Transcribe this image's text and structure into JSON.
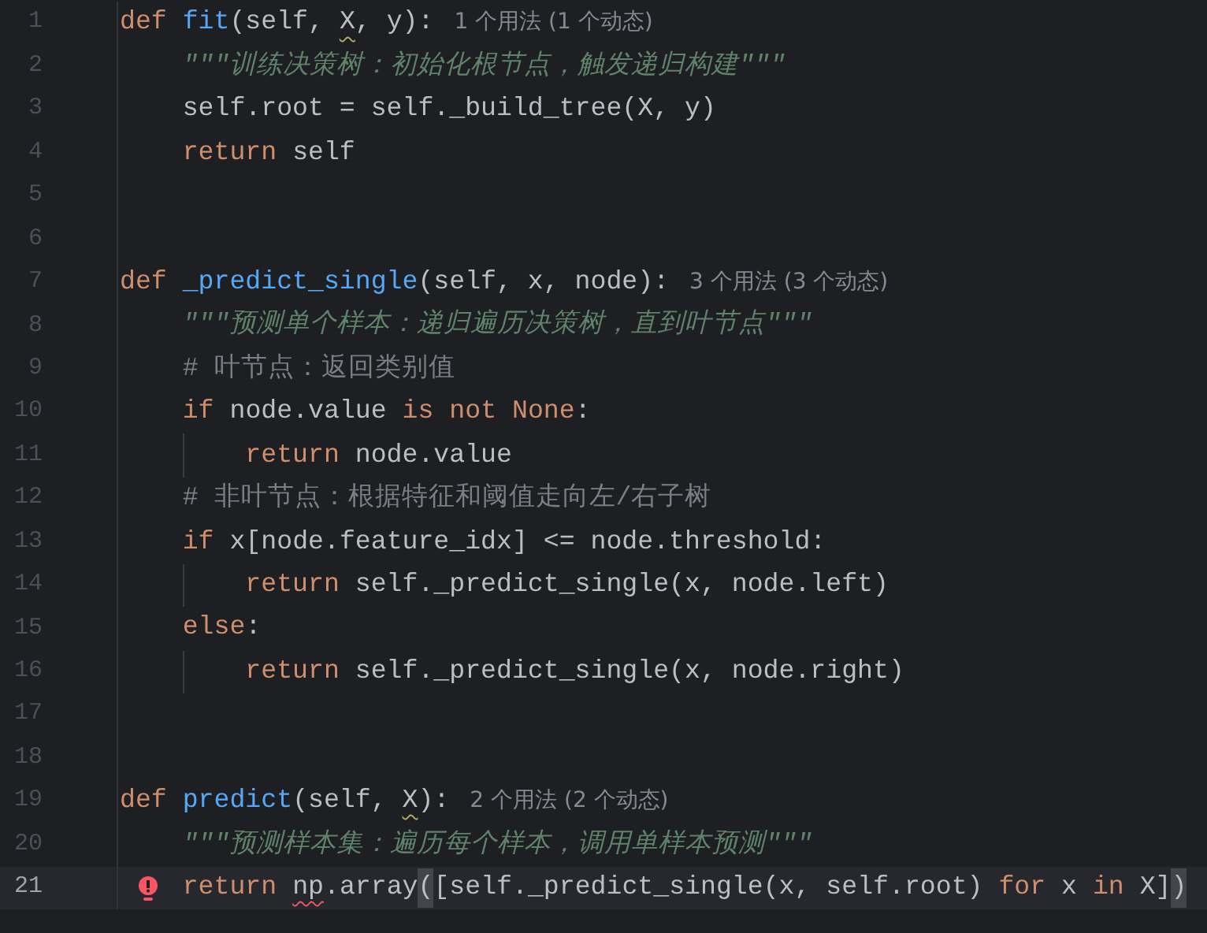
{
  "lines": [
    {
      "number": "1",
      "current": false,
      "error": false,
      "tokens": [
        {
          "kind": "kw",
          "text": "def"
        },
        {
          "kind": "fn",
          "text": " fit"
        },
        {
          "kind": "plain",
          "text": "(self, "
        },
        {
          "kind": "warn_name",
          "text": "X"
        },
        {
          "kind": "plain",
          "text": ", y):"
        },
        {
          "kind": "hint",
          "text": "1 个用法 (1 个动态)"
        }
      ]
    },
    {
      "number": "2",
      "current": false,
      "error": false,
      "tokens": [
        {
          "kind": "doc",
          "text": "    \"\"\"训练决策树：初始化根节点，触发递归构建\"\"\""
        }
      ]
    },
    {
      "number": "3",
      "current": false,
      "error": false,
      "tokens": [
        {
          "kind": "plain",
          "text": "    self.root = self._build_tree(X, y)"
        }
      ]
    },
    {
      "number": "4",
      "current": false,
      "error": false,
      "tokens": [
        {
          "kind": "kw",
          "text": "    return"
        },
        {
          "kind": "plain",
          "text": " self"
        }
      ]
    },
    {
      "number": "5",
      "current": false,
      "error": false
    },
    {
      "number": "6",
      "current": false,
      "error": false
    },
    {
      "number": "7",
      "current": false,
      "error": false,
      "tokens": [
        {
          "kind": "kw",
          "text": "def"
        },
        {
          "kind": "fn",
          "text": " _predict_single"
        },
        {
          "kind": "plain",
          "text": "(self, x, node):"
        },
        {
          "kind": "hint",
          "text": "3 个用法 (3 个动态)"
        }
      ]
    },
    {
      "number": "8",
      "current": false,
      "error": false,
      "tokens": [
        {
          "kind": "doc",
          "text": "    \"\"\"预测单个样本：递归遍历决策树，直到叶节点\"\"\""
        }
      ]
    },
    {
      "number": "9",
      "current": false,
      "error": false,
      "tokens": [
        {
          "kind": "comment",
          "text": "    # 叶节点：返回类别值"
        }
      ]
    },
    {
      "number": "10",
      "current": false,
      "error": false,
      "tokens": [
        {
          "kind": "kw",
          "text": "    if"
        },
        {
          "kind": "plain",
          "text": " node.value "
        },
        {
          "kind": "kw",
          "text": "is not None"
        },
        {
          "kind": "plain",
          "text": ":"
        }
      ]
    },
    {
      "number": "11",
      "current": false,
      "error": false,
      "tokens": [
        {
          "kind": "kw",
          "text": "        return"
        },
        {
          "kind": "plain",
          "text": " node.value"
        }
      ]
    },
    {
      "number": "12",
      "current": false,
      "error": false,
      "tokens": [
        {
          "kind": "comment",
          "text": "    # 非叶节点：根据特征和阈值走向左/右子树"
        }
      ]
    },
    {
      "number": "13",
      "current": false,
      "error": false,
      "tokens": [
        {
          "kind": "kw",
          "text": "    if"
        },
        {
          "kind": "plain",
          "text": " x[node.feature_idx] <= node.threshold:"
        }
      ]
    },
    {
      "number": "14",
      "current": false,
      "error": false,
      "tokens": [
        {
          "kind": "kw",
          "text": "        return"
        },
        {
          "kind": "plain",
          "text": " self._predict_single(x, node.left)"
        }
      ]
    },
    {
      "number": "15",
      "current": false,
      "error": false,
      "tokens": [
        {
          "kind": "kw",
          "text": "    else"
        },
        {
          "kind": "plain",
          "text": ":"
        }
      ]
    },
    {
      "number": "16",
      "current": false,
      "error": false,
      "tokens": [
        {
          "kind": "kw",
          "text": "        return"
        },
        {
          "kind": "plain",
          "text": " self._predict_single(x, node.right)"
        }
      ]
    },
    {
      "number": "17",
      "current": false,
      "error": false
    },
    {
      "number": "18",
      "current": false,
      "error": false
    },
    {
      "number": "19",
      "current": false,
      "error": false,
      "tokens": [
        {
          "kind": "kw",
          "text": "def"
        },
        {
          "kind": "fn",
          "text": " predict"
        },
        {
          "kind": "plain",
          "text": "(self, "
        },
        {
          "kind": "warn_name",
          "text": "X"
        },
        {
          "kind": "plain",
          "text": "):"
        },
        {
          "kind": "hint",
          "text": "2 个用法 (2 个动态)"
        }
      ]
    },
    {
      "number": "20",
      "current": false,
      "error": false,
      "tokens": [
        {
          "kind": "doc",
          "text": "    \"\"\"预测样本集：遍历每个样本，调用单样本预测\"\"\""
        }
      ]
    },
    {
      "number": "21",
      "current": true,
      "error": true,
      "tokens": [
        {
          "kind": "kw",
          "text": "    return"
        },
        {
          "kind": "error_name",
          "text": " np"
        },
        {
          "kind": "plain",
          "text": ".array"
        },
        {
          "kind": "brace",
          "text": "("
        },
        {
          "kind": "plain",
          "text": "[self._predict_single(x, self.root) "
        },
        {
          "kind": "kw",
          "text": "for"
        },
        {
          "kind": "plain",
          "text": " x "
        },
        {
          "kind": "kw",
          "text": "in"
        },
        {
          "kind": "plain",
          "text": " X]"
        },
        {
          "kind": "brace",
          "text": ")"
        }
      ]
    }
  ]
}
